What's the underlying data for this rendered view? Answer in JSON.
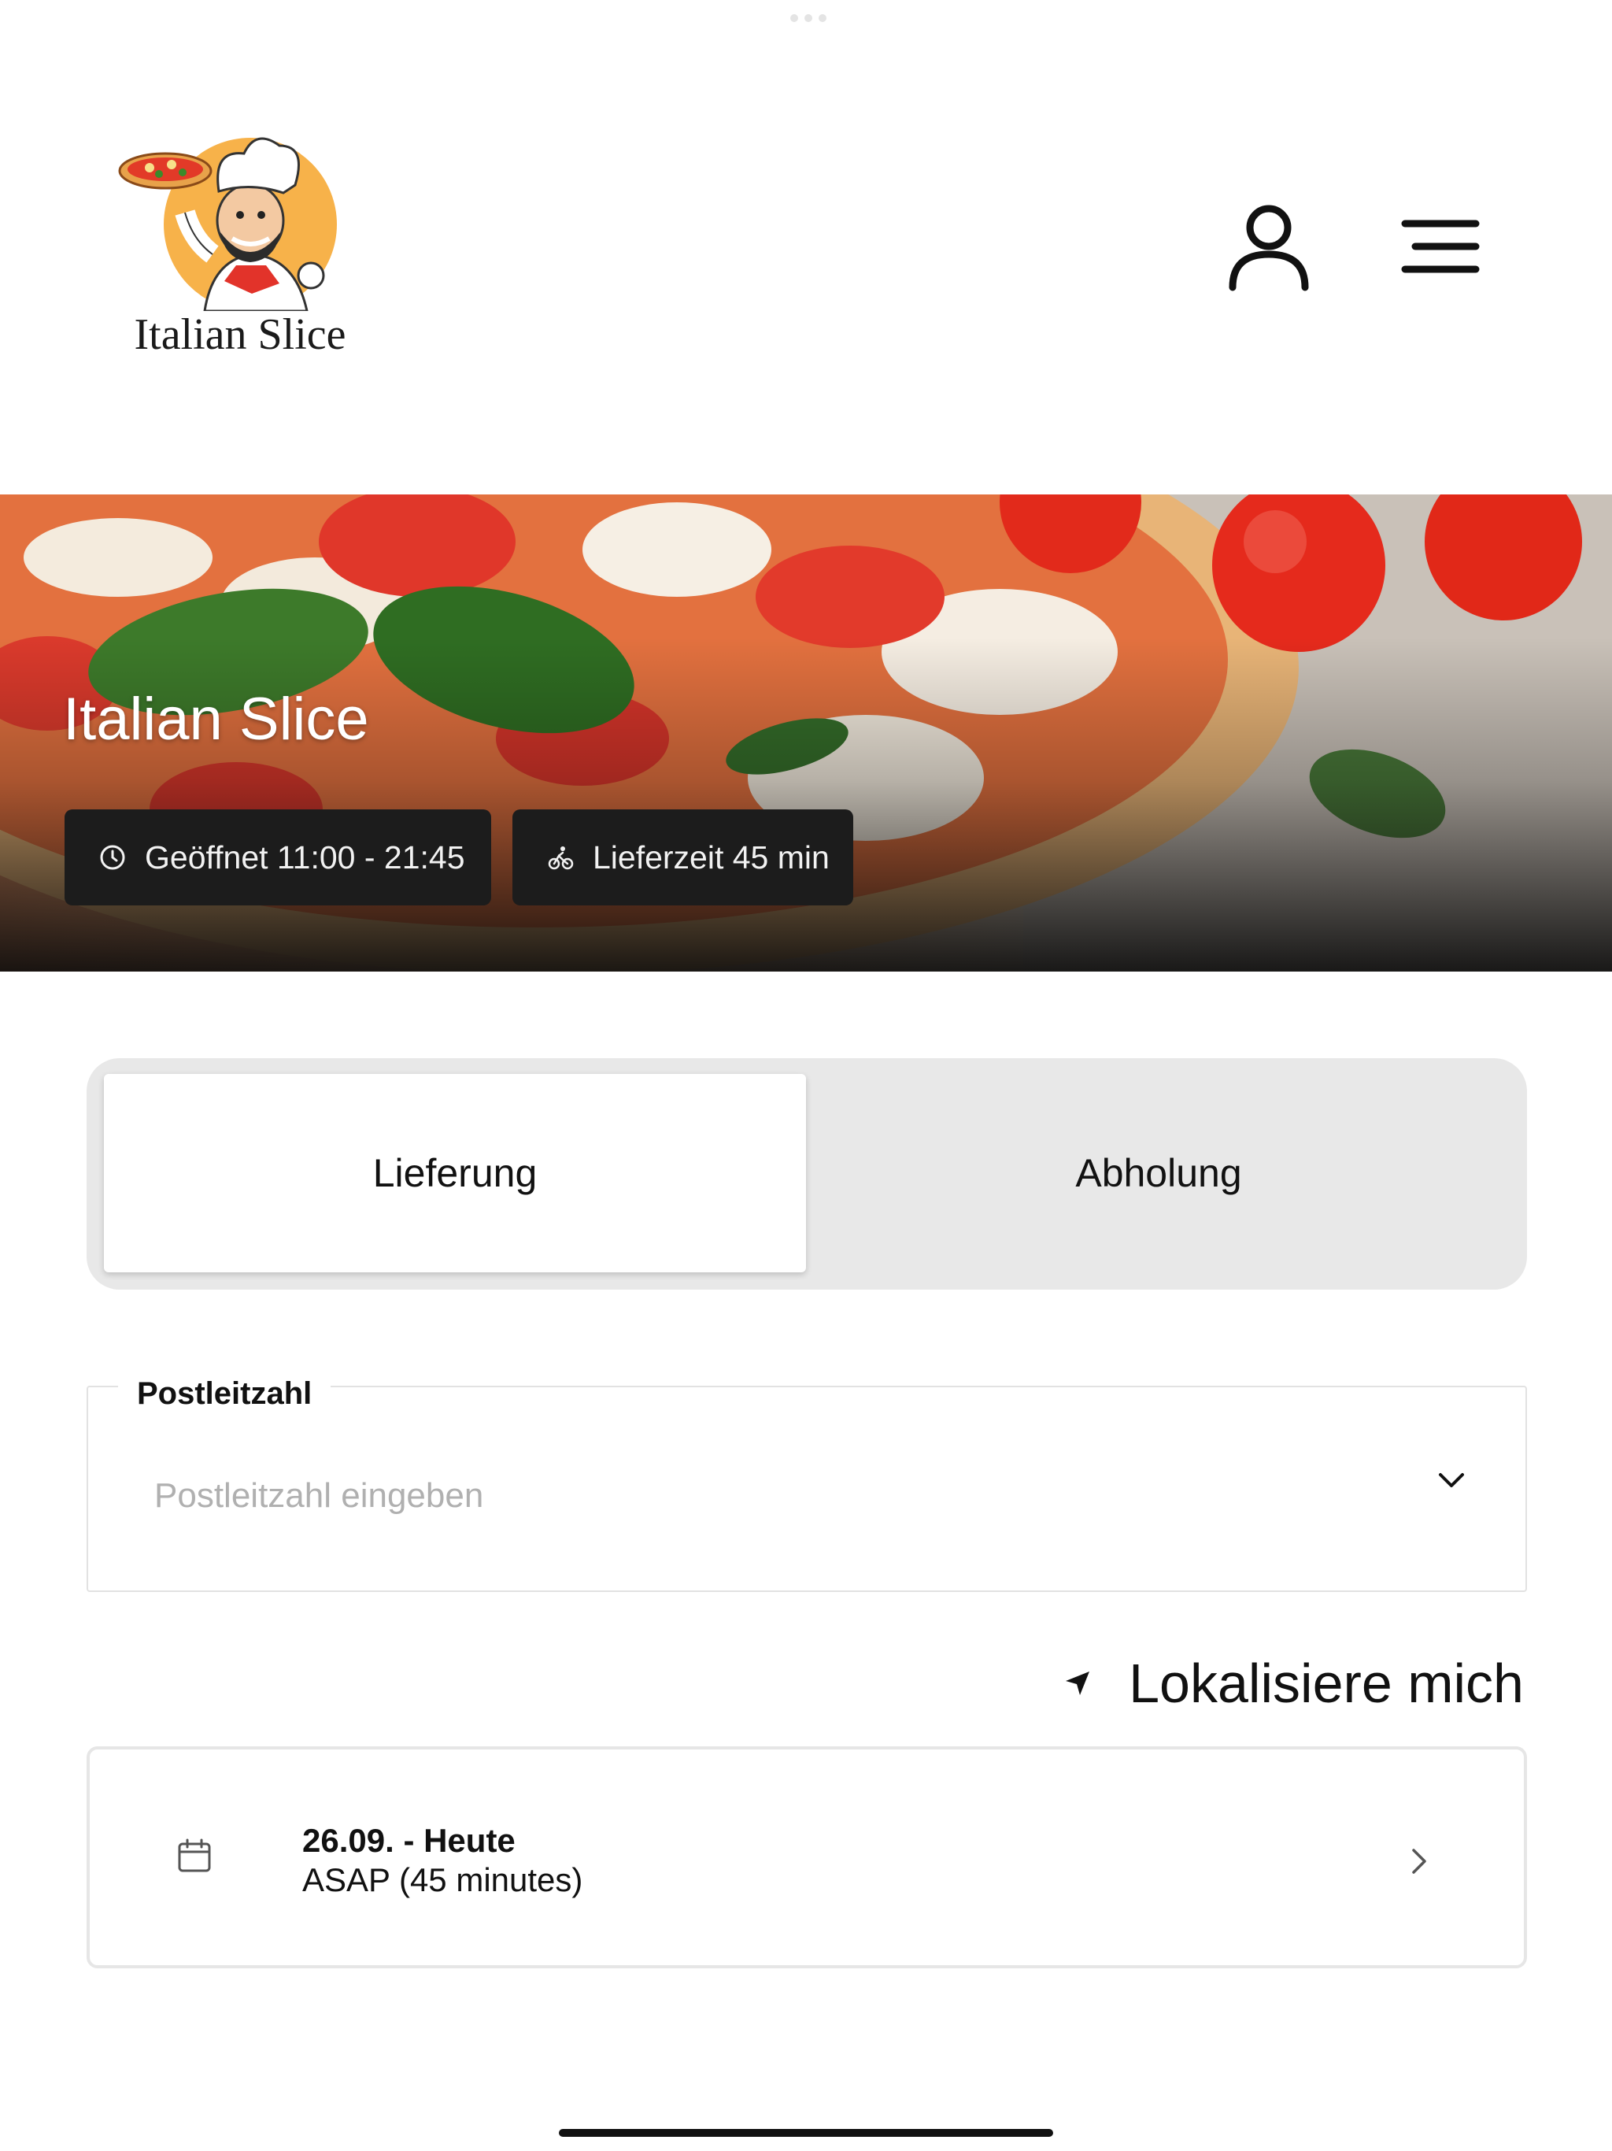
{
  "header": {
    "logo_text": "Italian Slice",
    "user_icon": "user-icon",
    "menu_icon": "hamburger-menu-icon"
  },
  "hero": {
    "title": "Italian Slice",
    "opening_hours": "Geöffnet 11:00 - 21:45",
    "delivery_time": "Lieferzeit 45 min"
  },
  "order_type": {
    "options": [
      "Lieferung",
      "Abholung"
    ],
    "selected": "Lieferung"
  },
  "postal": {
    "label": "Postleitzahl",
    "placeholder": "Postleitzahl eingeben",
    "value": ""
  },
  "localize": {
    "label": "Lokalisiere mich"
  },
  "schedule": {
    "date": "26.09. - Heute",
    "time": "ASAP (45 minutes)"
  },
  "colors": {
    "badge_bg": "#1c1c1c",
    "segment_bg": "#e8e8e8",
    "logo_circle": "#f7b24a",
    "scarf_red": "#e2332a"
  }
}
